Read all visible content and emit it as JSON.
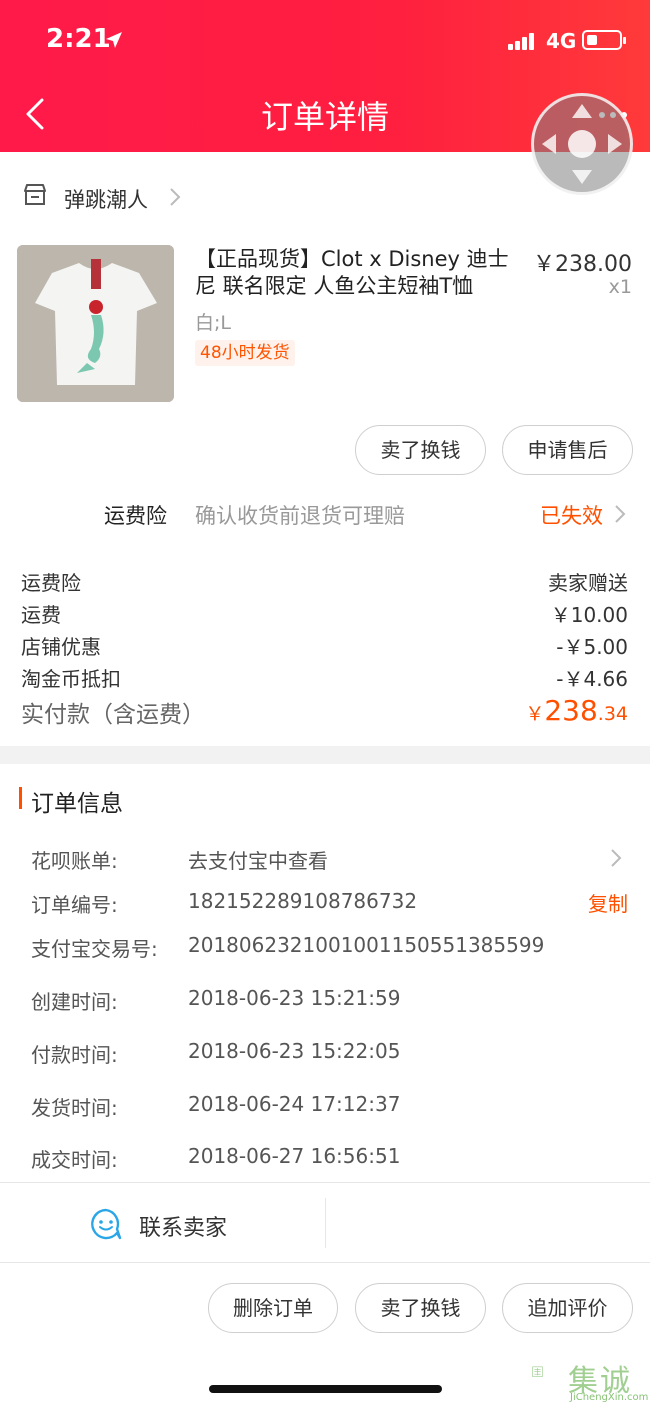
{
  "status_bar": {
    "time": "2:21",
    "network": "4G"
  },
  "header": {
    "title": "订单详情"
  },
  "shop": {
    "name": "弹跳潮人"
  },
  "product": {
    "title": "【正品现货】Clot x Disney 迪士尼 联名限定 人鱼公主短袖T恤",
    "price": "￥238.00",
    "quantity": "x1",
    "sku": "白;L",
    "tag": "48小时发货"
  },
  "item_actions": {
    "sell": "卖了换钱",
    "after_sale": "申请售后"
  },
  "insurance": {
    "label": "运费险",
    "desc": "确认收货前退货可理赔",
    "status": "已失效"
  },
  "fees": [
    {
      "label": "运费险",
      "value": "卖家赠送"
    },
    {
      "label": "运费",
      "value": "￥10.00"
    },
    {
      "label": "店铺优惠",
      "value": "-￥5.00"
    },
    {
      "label": "淘金币抵扣",
      "value": "-￥4.66"
    }
  ],
  "total": {
    "label": "实付款（含运费）",
    "currency": "￥",
    "integer": "238",
    "decimal": ".34"
  },
  "order_info": {
    "title": "订单信息",
    "copy_label": "复制",
    "rows": [
      {
        "label": "花呗账单:",
        "value": "去支付宝中查看"
      },
      {
        "label": "订单编号:",
        "value": "182152289108786732"
      },
      {
        "label": "支付宝交易号:",
        "value": "2018062321001001150551385599"
      },
      {
        "label": "创建时间:",
        "value": "2018-06-23 15:21:59"
      },
      {
        "label": "付款时间:",
        "value": "2018-06-23 15:22:05"
      },
      {
        "label": "发货时间:",
        "value": "2018-06-24 17:12:37"
      },
      {
        "label": "成交时间:",
        "value": "2018-06-27 16:56:51"
      }
    ]
  },
  "contact": {
    "label": "联系卖家"
  },
  "bottom_actions": {
    "delete": "删除订单",
    "sell": "卖了换钱",
    "review": "追加评价"
  },
  "watermark": {
    "cn": "集诚信",
    "en": "JiChengXin.com"
  },
  "colors": {
    "header": "#ff1f3f",
    "accent": "#ff5000"
  }
}
